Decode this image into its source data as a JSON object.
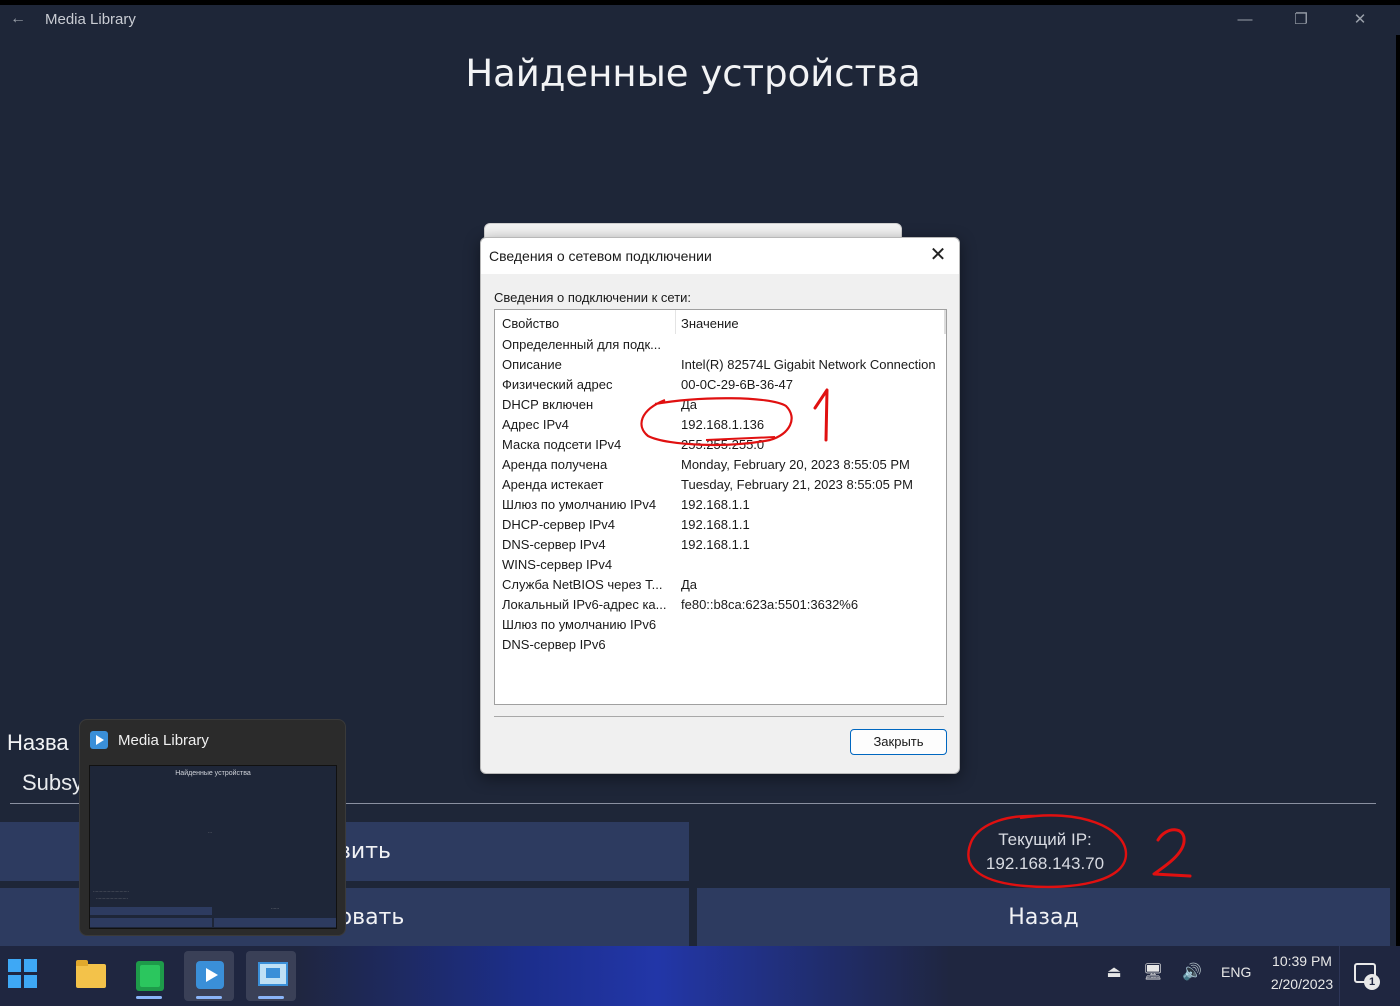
{
  "window": {
    "title": "Media Library",
    "back_icon": "←",
    "minimize_icon": "—",
    "restore_icon": "❐",
    "close_icon": "✕"
  },
  "page": {
    "title": "Найденные устройства",
    "name_label": "Назва",
    "name_value": "Subsy"
  },
  "buttons": {
    "add_label": "вить",
    "edit_label": "ровать",
    "back_label": "Назад"
  },
  "current_ip": {
    "label": "Текущий IP:",
    "value": "192.168.143.70"
  },
  "dialog": {
    "title": "Сведения о сетевом подключении",
    "close_icon": "✕",
    "section_label": "Сведения о подключении к сети:",
    "col_property": "Свойство",
    "col_value": "Значение",
    "rows": [
      {
        "k": "Определенный для подк...",
        "v": ""
      },
      {
        "k": "Описание",
        "v": "Intel(R) 82574L Gigabit Network Connection"
      },
      {
        "k": "Физический адрес",
        "v": "00-0C-29-6B-36-47"
      },
      {
        "k": "DHCP включен",
        "v": "Да"
      },
      {
        "k": "Адрес IPv4",
        "v": "192.168.1.136"
      },
      {
        "k": "Маска подсети IPv4",
        "v": "255.255.255.0"
      },
      {
        "k": "Аренда получена",
        "v": "Monday, February 20, 2023 8:55:05 PM"
      },
      {
        "k": "Аренда истекает",
        "v": "Tuesday, February 21, 2023 8:55:05 PM"
      },
      {
        "k": "Шлюз по умолчанию IPv4",
        "v": "192.168.1.1"
      },
      {
        "k": "DHCP-сервер IPv4",
        "v": "192.168.1.1"
      },
      {
        "k": "DNS-сервер IPv4",
        "v": "192.168.1.1"
      },
      {
        "k": "WINS-сервер IPv4",
        "v": ""
      },
      {
        "k": "Служба NetBIOS через Т...",
        "v": "Да"
      },
      {
        "k": "Локальный IPv6-адрес ка...",
        "v": "fe80::b8ca:623a:5501:3632%6"
      },
      {
        "k": "Шлюз по умолчанию IPv6",
        "v": ""
      },
      {
        "k": "DNS-сервер IPv6",
        "v": ""
      }
    ],
    "close_button": "Закрыть"
  },
  "annotations": {
    "mark_1": "1",
    "mark_2": "2",
    "color": "#e01010"
  },
  "preview": {
    "title": "Media Library",
    "thumb_heading": "Найденные устройства"
  },
  "taskbar": {
    "lang": "ENG",
    "time": "10:39 PM",
    "date": "2/20/2023",
    "notification_count": "1",
    "apps": [
      "start-icon",
      "file-explorer-icon",
      "green-app-icon",
      "media-library-icon",
      "remote-desktop-icon"
    ]
  }
}
